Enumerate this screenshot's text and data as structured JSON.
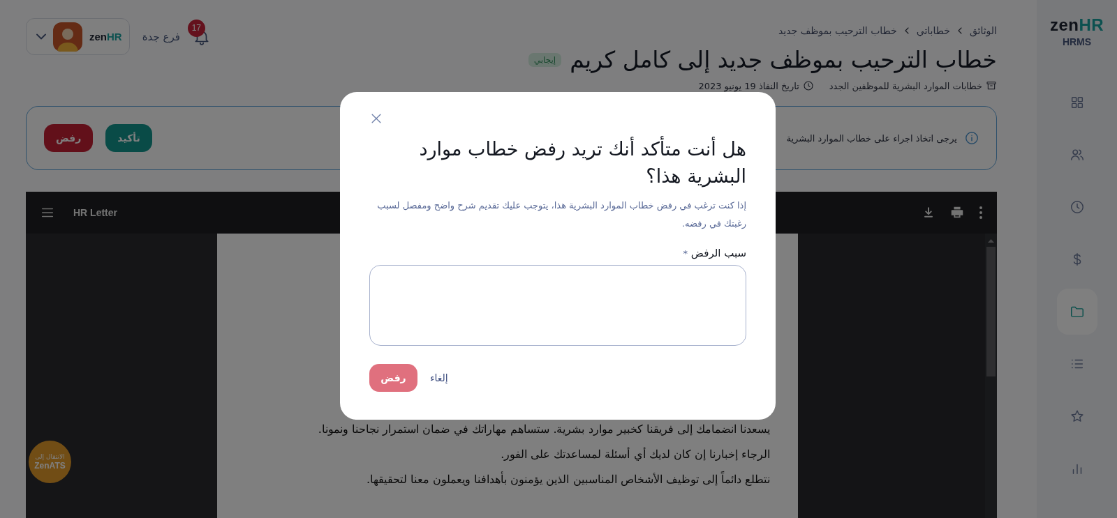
{
  "sidebar": {
    "logo": {
      "primary": "zen",
      "accent": "HR"
    },
    "product": "HRMS",
    "nav": [
      {
        "kind": "grid",
        "selected": false
      },
      {
        "kind": "users",
        "selected": false
      },
      {
        "kind": "clock",
        "selected": false
      },
      {
        "kind": "dollar",
        "selected": false
      },
      {
        "kind": "folder",
        "selected": true
      },
      {
        "kind": "list",
        "selected": false
      },
      {
        "kind": "star",
        "selected": false
      },
      {
        "kind": "chart",
        "selected": false
      }
    ]
  },
  "header": {
    "account_logo": {
      "primary": "zen",
      "accent": "HR"
    },
    "notifications": "17",
    "branch": "فرع جدة"
  },
  "breadcrumb": [
    "الوثائق",
    "خطاباتي",
    "خطاب الترحيب بموظف جديد"
  ],
  "title": "خطاب الترحيب بموظف جديد إلى كامل كريم",
  "status_badge": "إيجابي",
  "meta": [
    {
      "kind": "category",
      "text": "خطابات الموارد البشرية للموظفين الجدد"
    },
    {
      "kind": "date",
      "text": "تاريخ النفاذ 19 يونيو 2023"
    }
  ],
  "action_notice": {
    "text": "يرجى اتخاذ اجراء على خطاب الموارد البشرية",
    "buttons": [
      {
        "kind": "confirm",
        "label": "تأكيد"
      },
      {
        "kind": "reject",
        "label": "رفض"
      }
    ]
  },
  "viewer": {
    "title": "HR Letter",
    "paragraphs": [
      "يسعدنا انضمامك إلى فريقنا كخبير موارد بشرية. ستساهم مهاراتك في ضمان استمرار نجاحنا ونمونا.",
      "الرجاء إخبارنا إن كان لديك أي أسئلة لمساعدتك على الفور.",
      "نتطلع دائماً إلى توظيف الأشخاص المناسبين الذين يؤمنون بأهدافنا ويعملون معنا لتحقيقها."
    ]
  },
  "ats_shortcut": {
    "line1": "الانتقال إلى",
    "line2": "ZenATS"
  },
  "dialog": {
    "title": "هل أنت متأكد أنك تريد رفض خطاب موارد البشرية هذا؟",
    "message": "إذا كنت ترغب في رفض خطاب الموارد البشرية هذا، يتوجب عليك تقديم شرح واضح ومفصل لسبب رغبتك في رفضه.",
    "field_label": "سبب الرفض",
    "required_mark": "*",
    "buttons": [
      {
        "kind": "cancel",
        "label": "إلغاء"
      },
      {
        "kind": "reject",
        "label": "رفض"
      }
    ]
  }
}
